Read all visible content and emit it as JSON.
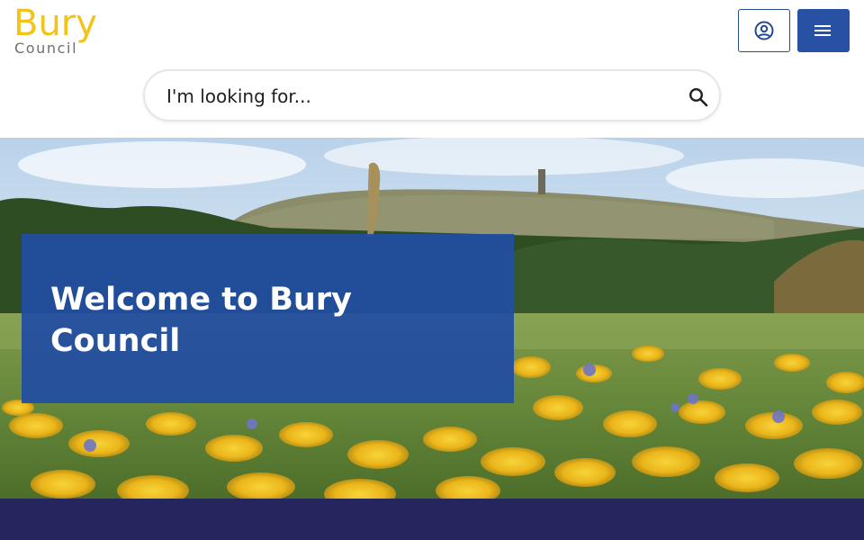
{
  "logo": {
    "primary": "Bury",
    "secondary": "Council"
  },
  "header": {
    "account_icon": "account-circle-icon",
    "menu_icon": "hamburger-menu-icon"
  },
  "search": {
    "placeholder": "I'm looking for...",
    "icon": "search-icon"
  },
  "hero": {
    "title": "Welcome to Bury Council"
  },
  "colors": {
    "brand_yellow": "#f2c318",
    "brand_grey": "#6f6f72",
    "primary_blue": "#2851a3",
    "hero_panel": "#214ea3",
    "band_navy": "#25265e"
  }
}
